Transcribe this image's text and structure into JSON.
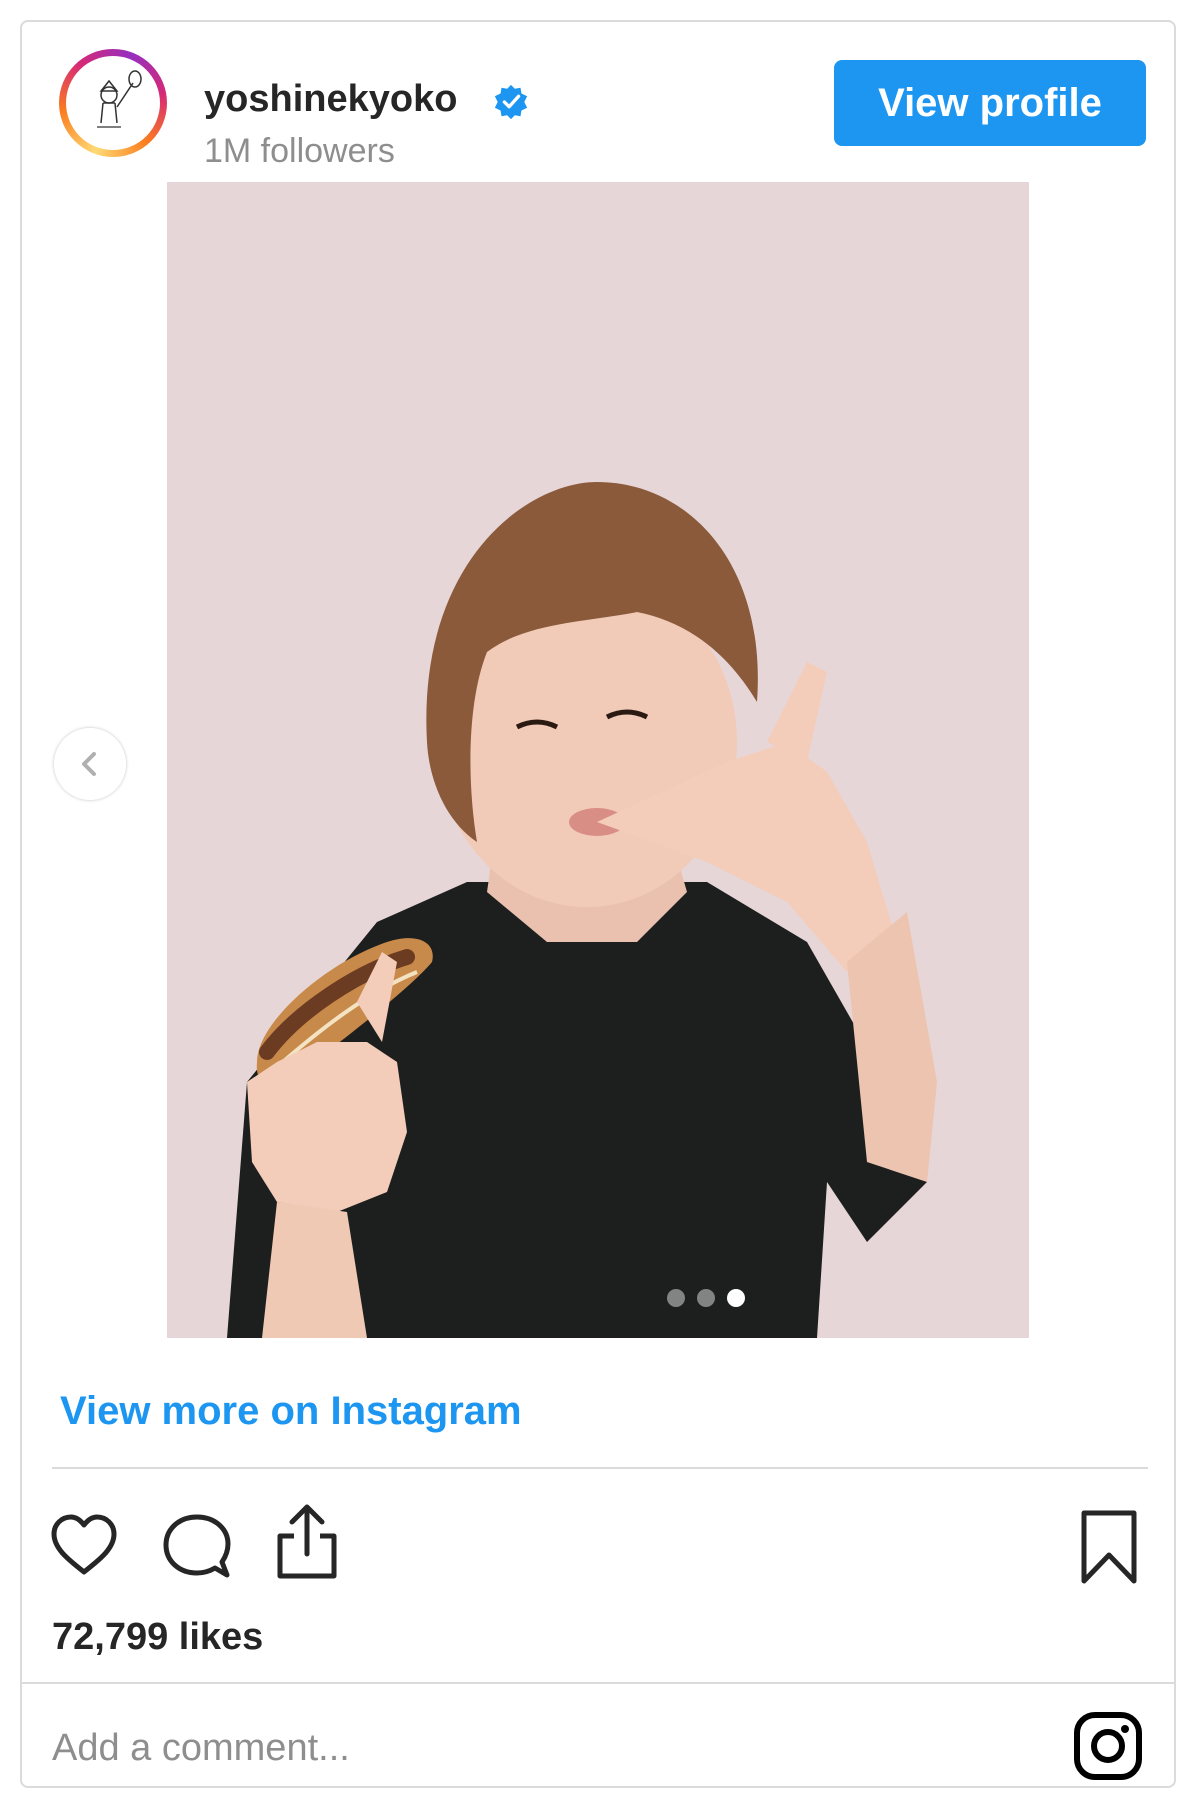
{
  "header": {
    "username": "yoshinekyoko",
    "followers": "1M followers",
    "view_profile_label": "View profile"
  },
  "carousel": {
    "total_slides": 3,
    "active_slide": 3
  },
  "links": {
    "view_more": "View more on Instagram"
  },
  "engagement": {
    "likes": "72,799 likes"
  },
  "comment": {
    "placeholder": "Add a comment..."
  },
  "colors": {
    "accent": "#1c96f0",
    "photo_background": "#e7d6d7",
    "divider": "#dbdbdb"
  },
  "icons": {
    "verified": "verified-badge-icon",
    "like": "heart-icon",
    "comment": "comment-bubble-icon",
    "share": "share-icon",
    "save": "bookmark-icon",
    "instagram": "instagram-logo-icon",
    "prev": "chevron-left-icon"
  }
}
